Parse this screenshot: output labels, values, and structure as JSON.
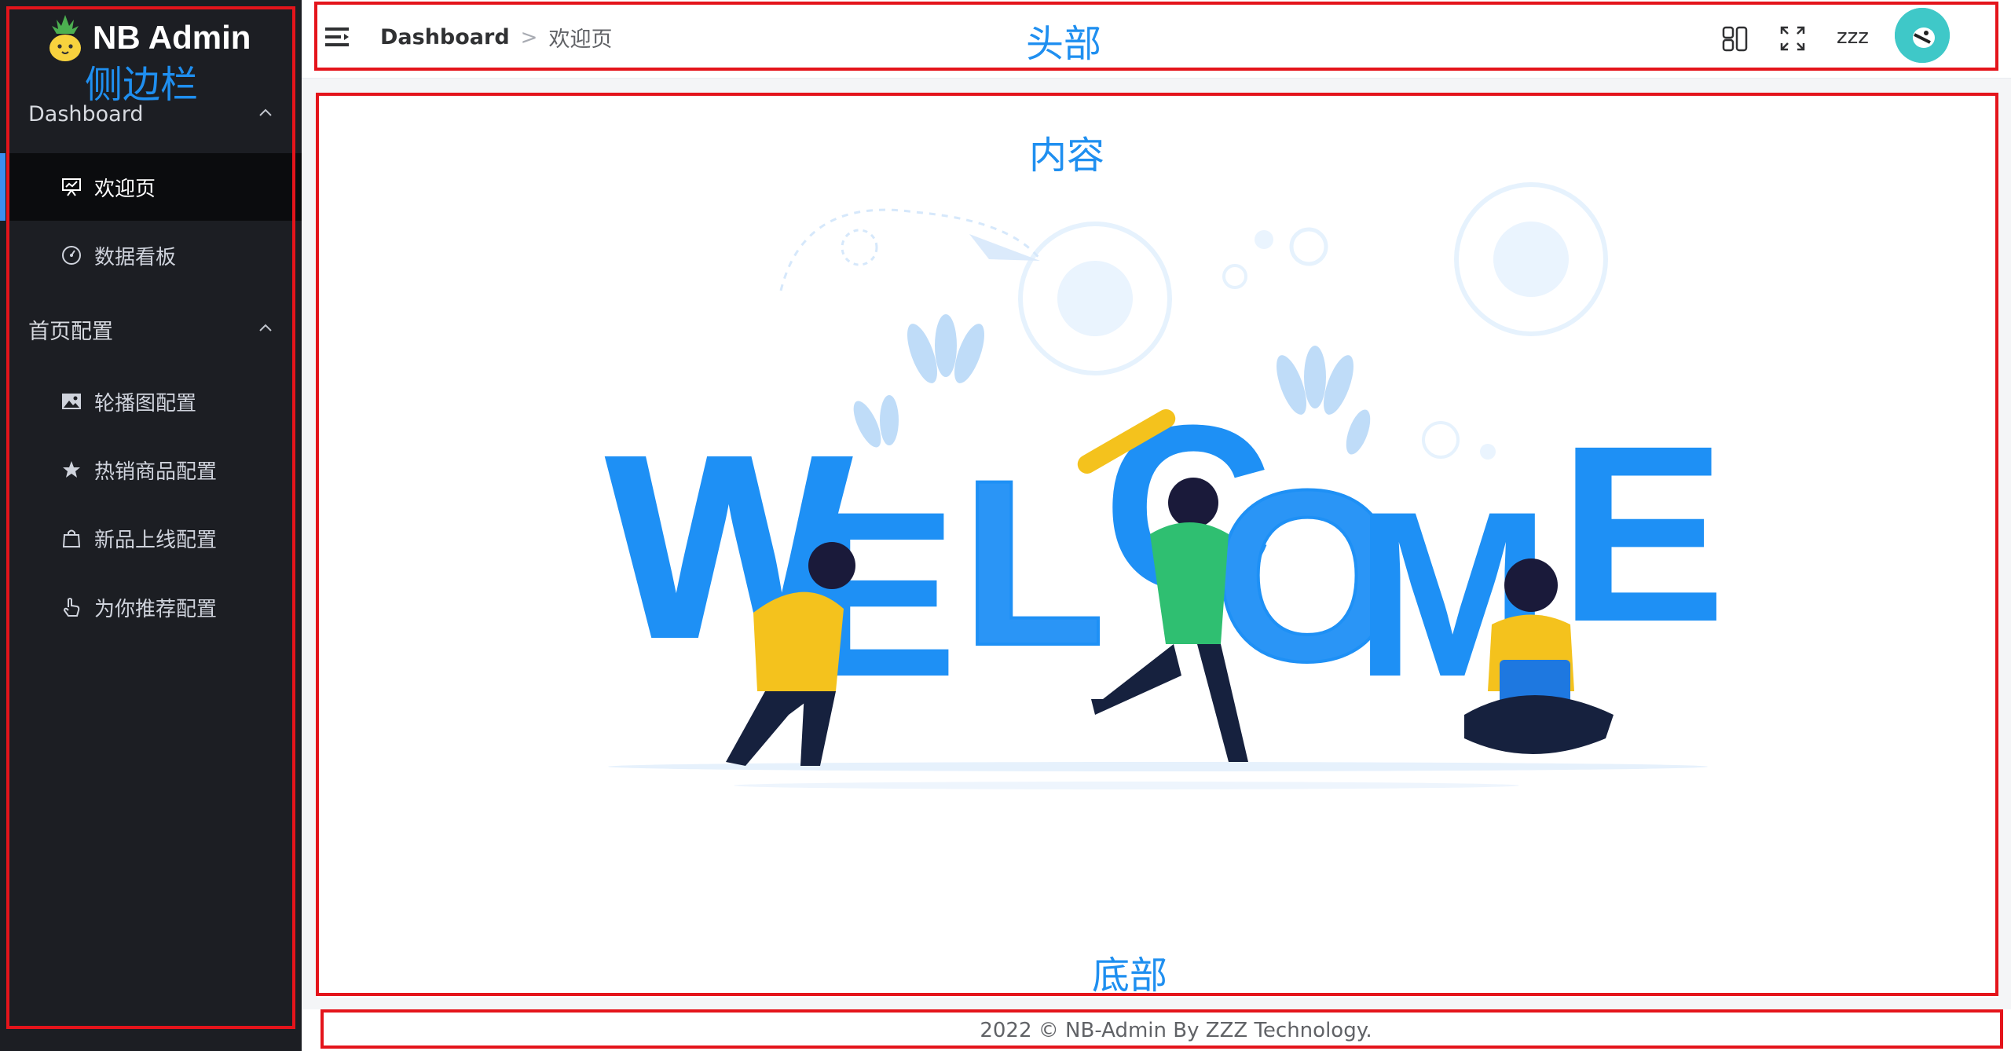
{
  "app": {
    "title": "NB Admin"
  },
  "sidebar": {
    "groups": [
      {
        "label": "Dashboard",
        "expanded": true,
        "items": [
          {
            "label": "欢迎页",
            "icon": "presentation-chart-icon",
            "active": true
          },
          {
            "label": "数据看板",
            "icon": "dashboard-gauge-icon",
            "active": false
          }
        ]
      },
      {
        "label": "首页配置",
        "expanded": true,
        "items": [
          {
            "label": "轮播图配置",
            "icon": "picture-icon",
            "active": false
          },
          {
            "label": "热销商品配置",
            "icon": "star-icon",
            "active": false
          },
          {
            "label": "新品上线配置",
            "icon": "shopping-bag-icon",
            "active": false
          },
          {
            "label": "为你推荐配置",
            "icon": "pointing-hand-icon",
            "active": false
          }
        ]
      }
    ]
  },
  "header": {
    "breadcrumb": {
      "root": "Dashboard",
      "separator": ">",
      "current": "欢迎页"
    },
    "username": "zzz"
  },
  "main": {
    "illustration_letters": [
      "W",
      "E",
      "L",
      "C",
      "O",
      "M",
      "E"
    ]
  },
  "footer": {
    "text": "2022 © NB-Admin By ZZZ Technology."
  },
  "annotations": {
    "sidebar": "侧边栏",
    "header": "头部",
    "content": "内容",
    "footer": "底部"
  },
  "colors": {
    "sidebar_bg": "#1c1e23",
    "accent": "#3b8ef0",
    "annotation_border": "#e4141b",
    "annotation_text": "#1f8ff0",
    "welcome_blue": "#1e90f5"
  }
}
